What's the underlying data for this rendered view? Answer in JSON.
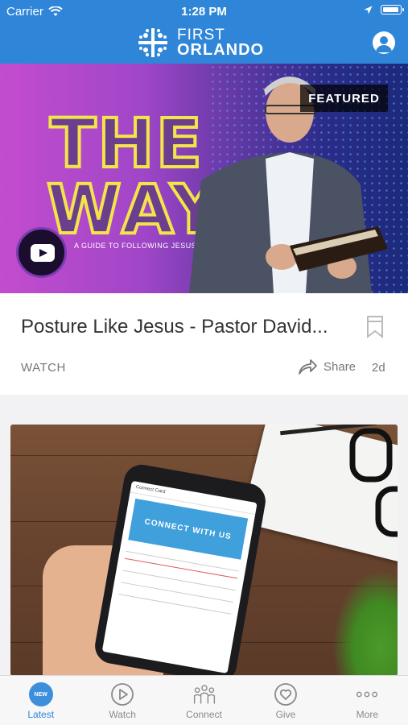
{
  "status_bar": {
    "carrier": "Carrier",
    "time": "1:28 PM"
  },
  "header": {
    "brand_line1": "FIRST",
    "brand_line2": "ORLANDO"
  },
  "featured": {
    "badge": "FEATURED",
    "hero_title_line1": "THE",
    "hero_title_line2": "WAY",
    "hero_subtitle": "A GUIDE TO FOLLOWING JESUS",
    "title": "Posture Like Jesus - Pastor David...",
    "type": "WATCH",
    "share_label": "Share",
    "age": "2d"
  },
  "card2": {
    "phone_header": "Connect Card",
    "phone_banner": "CONNECT WITH US"
  },
  "tabs": [
    {
      "label": "Latest",
      "badge": "NEW",
      "active": true
    },
    {
      "label": "Watch"
    },
    {
      "label": "Connect"
    },
    {
      "label": "Give"
    },
    {
      "label": "More"
    }
  ],
  "colors": {
    "brand_blue": "#2f86d8",
    "text_dark": "#333333",
    "text_muted": "#777777"
  }
}
